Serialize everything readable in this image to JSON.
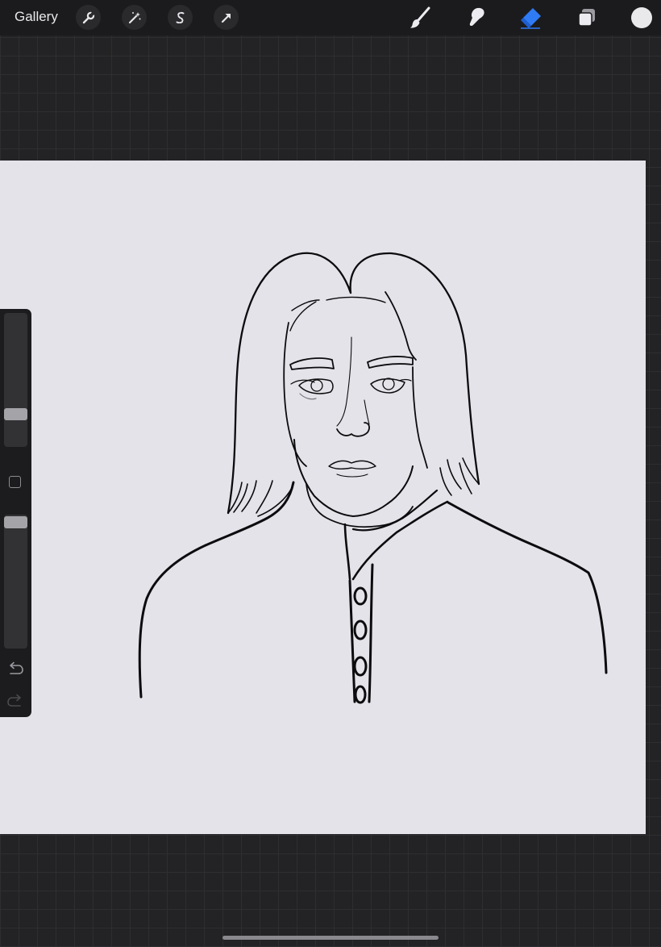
{
  "topbar": {
    "gallery_label": "Gallery",
    "left_tools": [
      "wrench-icon",
      "magic-wand-icon",
      "selection-icon",
      "transform-arrow-icon"
    ],
    "right_tools": [
      "brush-icon",
      "smudge-icon",
      "eraser-icon",
      "layers-icon"
    ],
    "active_tool": "eraser-icon",
    "active_color": "#2f7bf5",
    "current_color": "#e9e9ec"
  },
  "canvas": {
    "background": "#e4e3e9",
    "content": "line-art-portrait"
  },
  "sidebar": {
    "brush_size_level": 0.23,
    "opacity_level": 0.96,
    "tools": [
      "modify-button",
      "undo-icon",
      "redo-icon"
    ]
  }
}
